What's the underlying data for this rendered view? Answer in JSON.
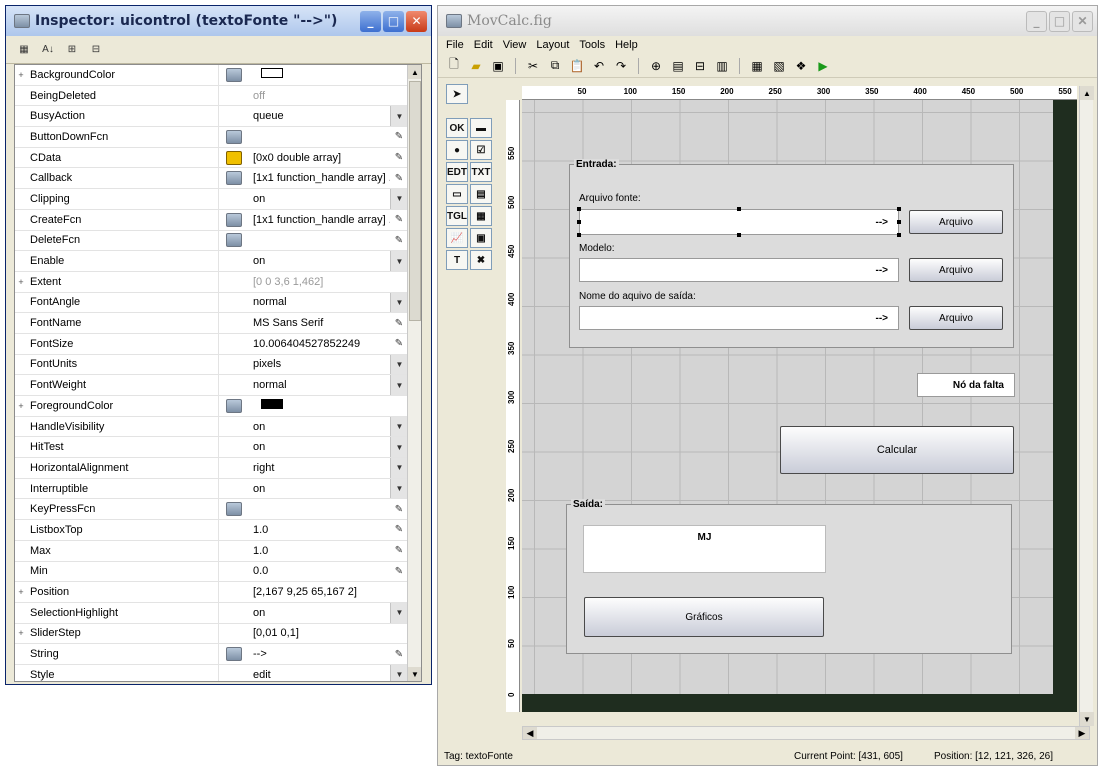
{
  "inspector": {
    "title": "Inspector:  uicontrol (textoFonte \"-->\")",
    "properties": [
      {
        "name": "BackgroundColor",
        "exp": "+",
        "icon": "color-icon",
        "value": "",
        "swatch": "white",
        "btn": ""
      },
      {
        "name": "BeingDeleted",
        "exp": "",
        "icon": "",
        "value": "off",
        "dim": true,
        "btn": ""
      },
      {
        "name": "BusyAction",
        "exp": "",
        "icon": "",
        "value": "queue",
        "btn": "dd"
      },
      {
        "name": "ButtonDownFcn",
        "exp": "",
        "icon": "edit-icon",
        "value": "",
        "btn": "pen"
      },
      {
        "name": "CData",
        "exp": "",
        "icon": "array-icon",
        "value": "[0x0  double array]",
        "btn": "pen"
      },
      {
        "name": "Callback",
        "exp": "",
        "icon": "edit-icon",
        "value": "[1x1  function_handle array] ...",
        "btn": "pen"
      },
      {
        "name": "Clipping",
        "exp": "",
        "icon": "",
        "value": "on",
        "btn": "dd"
      },
      {
        "name": "CreateFcn",
        "exp": "",
        "icon": "edit-icon",
        "value": "[1x1  function_handle array] ...",
        "btn": "pen"
      },
      {
        "name": "DeleteFcn",
        "exp": "",
        "icon": "edit-icon",
        "value": "",
        "btn": "pen"
      },
      {
        "name": "Enable",
        "exp": "",
        "icon": "",
        "value": "on",
        "btn": "dd"
      },
      {
        "name": "Extent",
        "exp": "+",
        "icon": "",
        "value": "[0 0 3,6 1,462]",
        "dim": true,
        "btn": ""
      },
      {
        "name": "FontAngle",
        "exp": "",
        "icon": "",
        "value": "normal",
        "btn": "dd"
      },
      {
        "name": "FontName",
        "exp": "",
        "icon": "",
        "value": "MS Sans Serif",
        "btn": "pen"
      },
      {
        "name": "FontSize",
        "exp": "",
        "icon": "",
        "value": "10.006404527852249",
        "btn": "pen"
      },
      {
        "name": "FontUnits",
        "exp": "",
        "icon": "",
        "value": "pixels",
        "btn": "dd"
      },
      {
        "name": "FontWeight",
        "exp": "",
        "icon": "",
        "value": "normal",
        "btn": "dd"
      },
      {
        "name": "ForegroundColor",
        "exp": "+",
        "icon": "color-icon",
        "value": "",
        "swatch": "black",
        "btn": ""
      },
      {
        "name": "HandleVisibility",
        "exp": "",
        "icon": "",
        "value": "on",
        "btn": "dd"
      },
      {
        "name": "HitTest",
        "exp": "",
        "icon": "",
        "value": "on",
        "btn": "dd"
      },
      {
        "name": "HorizontalAlignment",
        "exp": "",
        "icon": "",
        "value": "right",
        "btn": "dd"
      },
      {
        "name": "Interruptible",
        "exp": "",
        "icon": "",
        "value": "on",
        "btn": "dd"
      },
      {
        "name": "KeyPressFcn",
        "exp": "",
        "icon": "edit-icon",
        "value": "",
        "btn": "pen"
      },
      {
        "name": "ListboxTop",
        "exp": "",
        "icon": "",
        "value": "1.0",
        "btn": "pen"
      },
      {
        "name": "Max",
        "exp": "",
        "icon": "",
        "value": "1.0",
        "btn": "pen"
      },
      {
        "name": "Min",
        "exp": "",
        "icon": "",
        "value": "0.0",
        "btn": "pen"
      },
      {
        "name": "Position",
        "exp": "+",
        "icon": "",
        "value": "[2,167 9,25 65,167 2]",
        "btn": ""
      },
      {
        "name": "SelectionHighlight",
        "exp": "",
        "icon": "",
        "value": "on",
        "btn": "dd"
      },
      {
        "name": "SliderStep",
        "exp": "+",
        "icon": "",
        "value": "[0,01 0,1]",
        "btn": ""
      },
      {
        "name": "String",
        "exp": "",
        "icon": "string-icon",
        "value": "-->",
        "btn": "pen"
      },
      {
        "name": "Style",
        "exp": "",
        "icon": "",
        "value": "edit",
        "btn": "dd"
      }
    ]
  },
  "guide": {
    "title": "MovCalc.fig",
    "menu": [
      "File",
      "Edit",
      "View",
      "Layout",
      "Tools",
      "Help"
    ],
    "ruler_x": [
      "50",
      "100",
      "150",
      "200",
      "250",
      "300",
      "350",
      "400",
      "450",
      "500",
      "550"
    ],
    "ruler_y": [
      "550",
      "500",
      "450",
      "400",
      "350",
      "300",
      "250",
      "200",
      "150",
      "100",
      "50",
      "0"
    ],
    "entrada_title": "Entrada:",
    "arquivo_fonte_label": "Arquivo fonte:",
    "modelo_label": "Modelo:",
    "saida_arquivo_label": "Nome do aquivo de saída:",
    "edit_text": "-->",
    "arquivo_button": "Arquivo",
    "no_falta": "Nó da falta",
    "calcular_button": "Calcular",
    "saida_title": "Saída:",
    "mj_label": "MJ",
    "graficos_button": "Gráficos",
    "status_tag": "Tag: textoFonte",
    "status_point": "Current Point:  [431, 605]",
    "status_position": "Position: [12, 121, 326, 26]"
  }
}
